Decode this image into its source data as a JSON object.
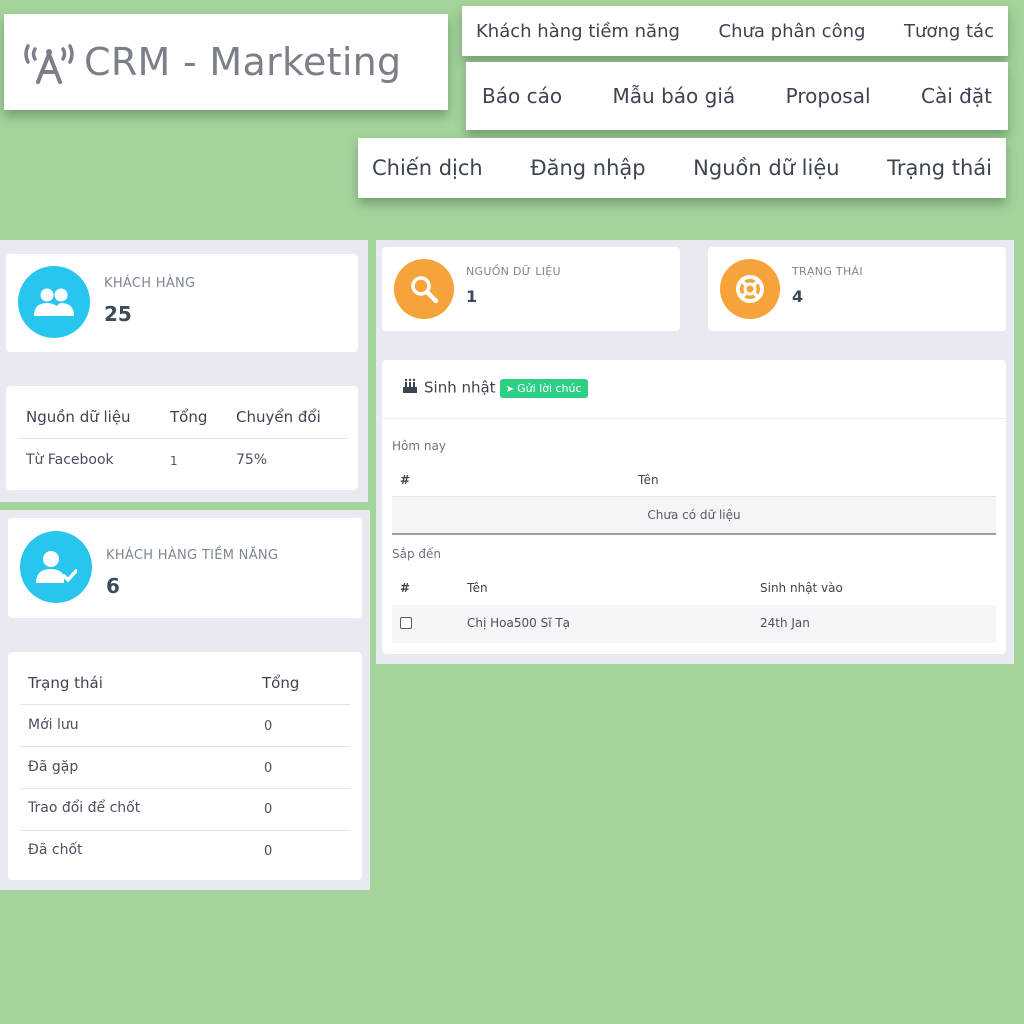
{
  "header": {
    "app_title": "CRM - Marketing",
    "logo_icon": "broadcast-tower-icon"
  },
  "nav": {
    "row1": [
      "Khách hàng tiềm năng",
      "Chưa phân công",
      "Tương tác"
    ],
    "row2": [
      "Báo cáo",
      "Mẫu báo giá",
      "Proposal",
      "Cài đặt"
    ],
    "row3": [
      "Chiến dịch",
      "Đăng nhập",
      "Nguồn dữ liệu",
      "Trạng thái"
    ]
  },
  "stats": {
    "customers": {
      "label": "KHÁCH HÀNG",
      "value": "25",
      "icon": "users-icon"
    },
    "leads": {
      "label": "KHÁCH HÀNG TIỀM NĂNG",
      "value": "6",
      "icon": "user-check-icon"
    },
    "sources": {
      "label": "NGUỒN DỮ LIỆU",
      "value": "1",
      "icon": "search-icon"
    },
    "statuses": {
      "label": "TRẠNG THÁI",
      "value": "4",
      "icon": "life-ring-icon"
    }
  },
  "sources_table": {
    "headers": [
      "Nguồn dữ liệu",
      "Tổng",
      "Chuyển đổi"
    ],
    "rows": [
      [
        "Từ Facebook",
        "1",
        "75%"
      ]
    ]
  },
  "status_table": {
    "headers": [
      "Trạng thái",
      "Tổng"
    ],
    "rows": [
      [
        "Mới lưu",
        "0"
      ],
      [
        "Đã gặp",
        "0"
      ],
      [
        "Trao đổi để chốt",
        "0"
      ],
      [
        "Đã chốt",
        "0"
      ]
    ]
  },
  "birthday": {
    "title": "Sinh nhật",
    "send_label": "Gửi lời chúc",
    "today_label": "Hôm nay",
    "today_headers": [
      "#",
      "Tên"
    ],
    "today_empty": "Chưa có dữ liệu",
    "upcoming_label": "Sắp đến",
    "upcoming_headers": [
      "#",
      "Tên",
      "Sinh nhật vào"
    ],
    "upcoming_rows": [
      [
        "Chị Hoa500 Sĩ Tạ",
        "24th Jan"
      ]
    ]
  },
  "colors": {
    "background": "#a4d49c",
    "cyan": "#28c6ee",
    "orange": "#f7a33c",
    "badge_green": "#2dcf84"
  }
}
